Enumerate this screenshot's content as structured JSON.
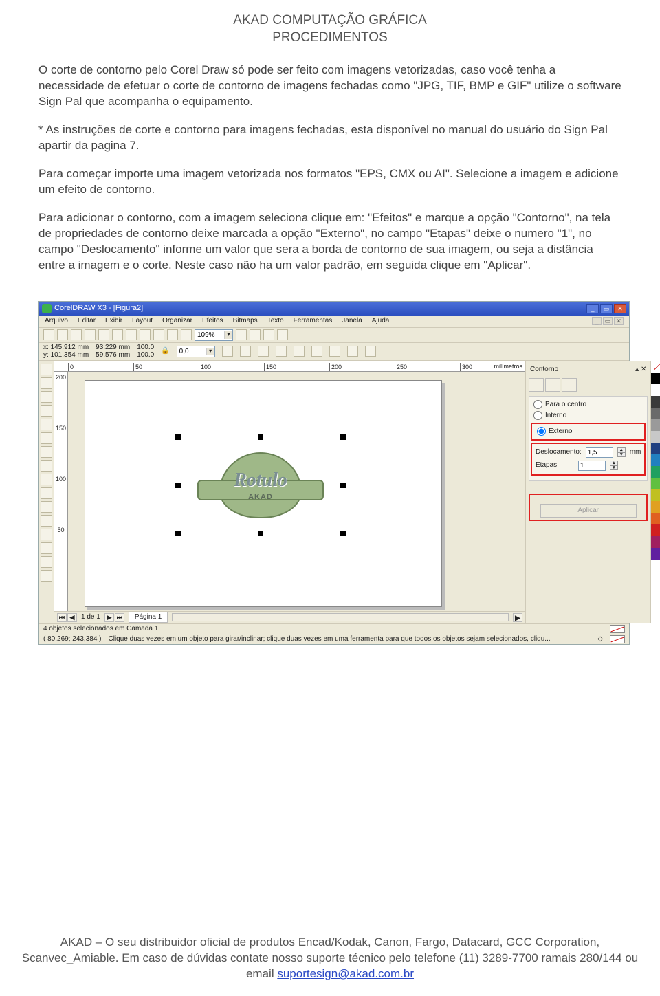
{
  "header": {
    "line1": "AKAD COMPUTAÇÃO GRÁFICA",
    "line2": "PROCEDIMENTOS"
  },
  "paragraphs": {
    "p1": "O corte de contorno pelo Corel Draw só pode ser feito com imagens vetorizadas, caso você tenha a necessidade de efetuar o corte de contorno de imagens fechadas como \"JPG, TIF, BMP e GIF\" utilize o software Sign Pal que acompanha o equipamento.",
    "p2": "* As instruções de corte e contorno para imagens fechadas, esta disponível no manual do usuário do Sign Pal apartir da pagina 7.",
    "p3": "Para começar importe uma imagem vetorizada nos formatos \"EPS, CMX ou AI\". Selecione a imagem e adicione um efeito de contorno.",
    "p4": "Para adicionar o contorno, com a imagem seleciona clique em: \"Efeitos\" e marque a opção \"Contorno\", na tela de propriedades de contorno deixe marcada a opção \"Externo\", no campo \"Etapas\" deixe o numero \"1\", no campo \"Deslocamento\" informe um valor que sera a borda de contorno de sua imagem, ou seja a distância entre a imagem e o corte. Neste caso não ha um valor padrão, em seguida clique em \"Aplicar\"."
  },
  "footer": {
    "text_before": "AKAD – O seu distribuidor oficial de produtos Encad/Kodak, Canon, Fargo, Datacard, GCC Corporation, Scanvec_Amiable. Em caso de dúvidas contate nosso suporte técnico pelo telefone  (11) 3289-7700 ramais 280/144 ou email ",
    "email": "suportesign@akad.com.br"
  },
  "screenshot": {
    "title": "CorelDRAW X3 - [Figura2]",
    "menus": [
      "Arquivo",
      "Editar",
      "Exibir",
      "Layout",
      "Organizar",
      "Efeitos",
      "Bitmaps",
      "Texto",
      "Ferramentas",
      "Janela",
      "Ajuda"
    ],
    "zoom": "109%",
    "props": {
      "x": "x: 145.912 mm",
      "y": "y: 101.354 mm",
      "w": "93.229 mm",
      "h": "59.576 mm",
      "sx": "100.0",
      "sy": "100.0",
      "rot": "0,0"
    },
    "ruler_h": [
      "0",
      "50",
      "100",
      "150",
      "200",
      "250",
      "300"
    ],
    "ruler_unit": "milímetros",
    "ruler_v": [
      "200",
      "150",
      "100",
      "50"
    ],
    "art": {
      "title": "Rotulo",
      "sub": "AKAD"
    },
    "docker": {
      "title": "Contorno",
      "r1": "Para o centro",
      "r2": "Interno",
      "r3": "Externo",
      "f1_label": "Deslocamento:",
      "f1_value": "1,5",
      "f1_unit": "mm",
      "f2_label": "Etapas:",
      "f2_value": "1",
      "apply": "Aplicar"
    },
    "palette": [
      "#000000",
      "#ffffff",
      "#3a3a3a",
      "#6a6a6a",
      "#9a9a9a",
      "#c8c8c8",
      "#204080",
      "#2080c0",
      "#20a060",
      "#60c040",
      "#c0c020",
      "#e0a020",
      "#e06020",
      "#d02020",
      "#a02060",
      "#6020a0"
    ],
    "pagebar": {
      "count": "1 de 1",
      "tab": "Página 1"
    },
    "status1": "4 objetos selecionados em Camada 1",
    "status2_coord": "( 80,269; 243,384 )",
    "status2_hint": "Clique duas vezes em um objeto para girar/inclinar; clique duas vezes em uma ferramenta para que todos os objetos sejam selecionados, cliqu..."
  }
}
